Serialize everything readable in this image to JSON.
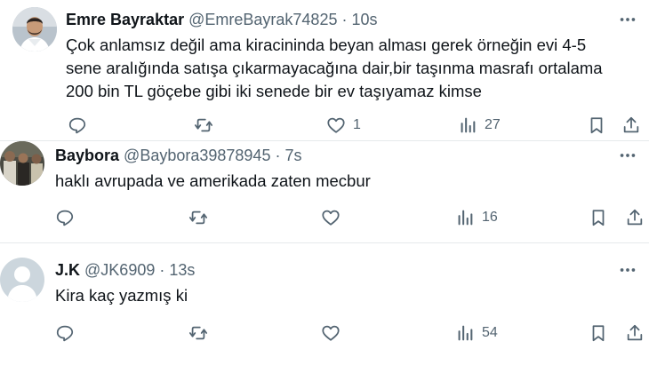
{
  "tweets": [
    {
      "author_name": "Emre Bayraktar",
      "handle": "@EmreBayrak74825",
      "separator": "·",
      "time": "10s",
      "text": "Çok anlamsız değil ama kiracininda beyan alması gerek örneğin evi 4-5\nsene aralığında satışa çıkarmayacağına dair,bir taşınma masrafı ortalama\n200 bin TL göçebe gibi iki senede bir ev taşıyamaz kimse",
      "likes": "1",
      "views": "27",
      "avatar": "profile-photo"
    },
    {
      "author_name": "Baybora",
      "handle": "@Baybora39878945",
      "separator": "·",
      "time": "7s",
      "text": "haklı avrupada ve amerikada zaten mecbur",
      "likes": "",
      "views": "16",
      "avatar": "group-photo"
    },
    {
      "author_name": "J.K",
      "handle": "@JK6909",
      "separator": "·",
      "time": "13s",
      "text": "Kira kaç yazmış ki",
      "likes": "",
      "views": "54",
      "avatar": "default-avatar"
    }
  ],
  "icons": {
    "more": "more-icon",
    "reply": "reply-icon",
    "retweet": "retweet-icon",
    "like": "heart-icon",
    "views": "views-icon",
    "bookmark": "bookmark-icon",
    "share": "share-icon"
  },
  "colors": {
    "text": "#0f1419",
    "secondary": "#536471",
    "divider": "#e6e9eb"
  }
}
